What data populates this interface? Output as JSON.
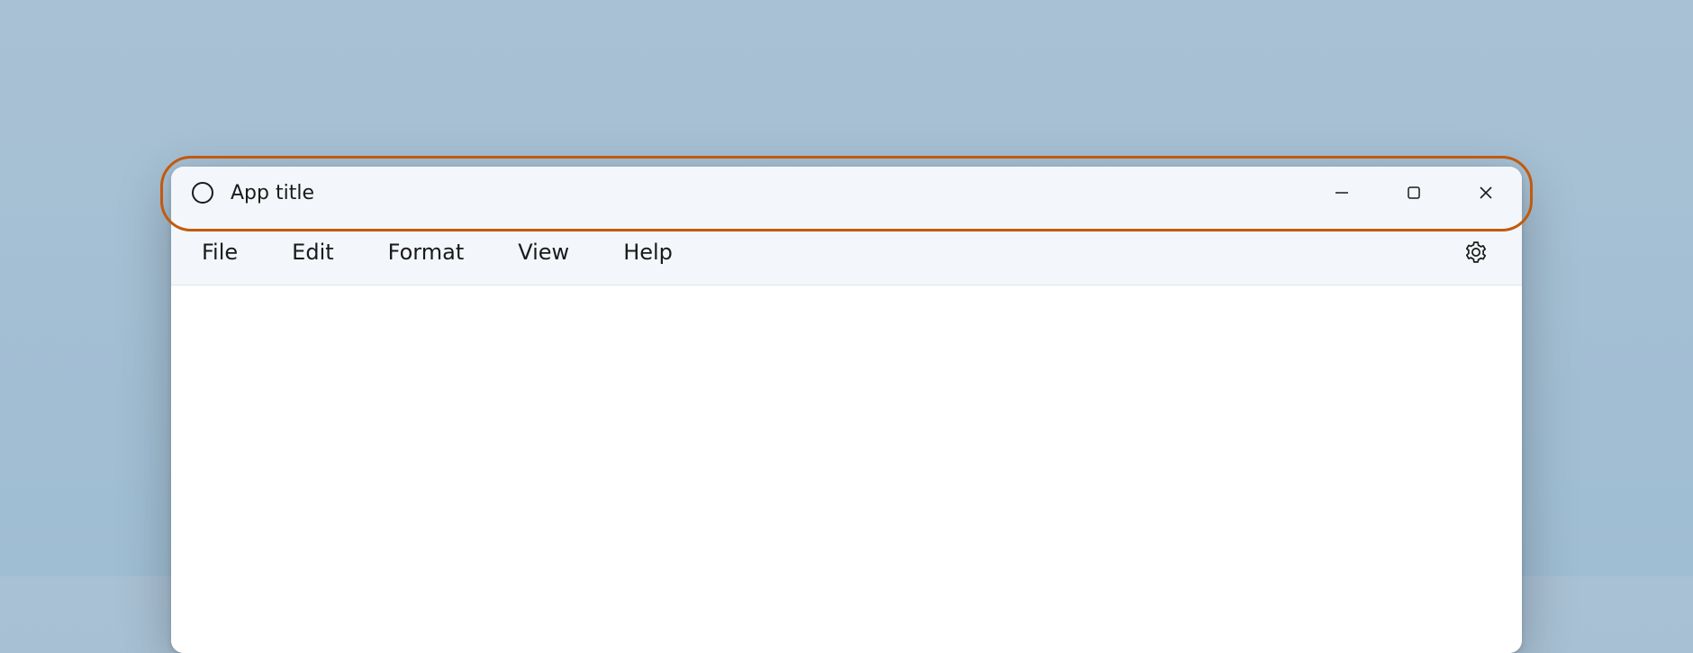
{
  "titlebar": {
    "app_title": "App title",
    "icon": "app-circle-icon",
    "caption": {
      "minimize": "minimize-icon",
      "maximize": "maximize-icon",
      "close": "close-icon"
    }
  },
  "menubar": {
    "items": [
      {
        "label": "File"
      },
      {
        "label": "Edit"
      },
      {
        "label": "Format"
      },
      {
        "label": "View"
      },
      {
        "label": "Help"
      }
    ],
    "settings_icon": "gear-icon"
  },
  "annotation": {
    "highlight_color": "#c25a0e",
    "highlight_target": "titlebar"
  }
}
